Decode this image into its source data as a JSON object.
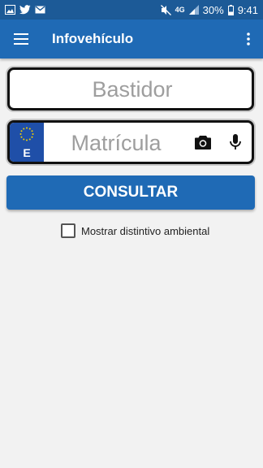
{
  "status_bar": {
    "network": "4G",
    "battery": "30%",
    "time": "9:41",
    "icons": [
      "image-icon",
      "twitter-icon",
      "gmail-icon",
      "mute-icon",
      "signal-icon",
      "battery-icon"
    ]
  },
  "app_bar": {
    "title": "Infovehículo",
    "menu_icon": "hamburger-menu-icon",
    "more_icon": "more-vert-icon",
    "color": "#1f6ab5"
  },
  "form": {
    "bastidor_placeholder": "Bastidor",
    "matricula_placeholder": "Matrícula",
    "country_code": "E",
    "eu_band_color": "#1f4fa8",
    "camera_icon": "camera-icon",
    "mic_icon": "microphone-icon",
    "consult_label": "CONSULTAR",
    "environmental_label": "Mostrar distintivo ambiental",
    "environmental_checked": false
  }
}
